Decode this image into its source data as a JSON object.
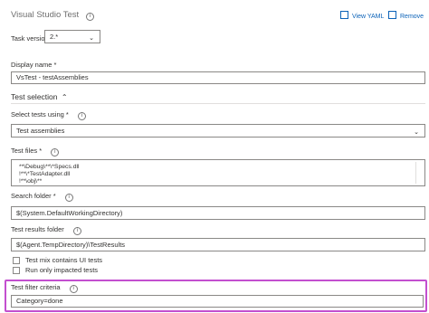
{
  "header": {
    "title": "Visual Studio Test",
    "view_yaml": "View YAML",
    "remove": "Remove"
  },
  "task_version": {
    "label": "Task version",
    "value": "2.*"
  },
  "display_name": {
    "label": "Display name *",
    "value": "VsTest - testAssemblies"
  },
  "section": {
    "title": "Test selection"
  },
  "select_tests_using": {
    "label": "Select tests using *",
    "value": "Test assemblies"
  },
  "test_files": {
    "label": "Test files *",
    "lines": [
      "**\\Debug\\**\\*Specs.dll",
      "!**\\*TestAdapter.dll",
      "!**\\obj\\**"
    ]
  },
  "search_folder": {
    "label": "Search folder *",
    "value": "$(System.DefaultWorkingDirectory)"
  },
  "test_results_folder": {
    "label": "Test results folder",
    "value": "$(Agent.TempDirectory)\\TestResults"
  },
  "test_filter": {
    "label": "Test filter criteria",
    "value": "Category=done"
  },
  "checkboxes": {
    "impacted": "Run only impacted tests",
    "ui_tests": "Test mix contains UI tests"
  },
  "colors": {
    "highlight": "#c34fcf",
    "link": "#0b62b8"
  },
  "icons": [
    "info-icon",
    "view-yaml-icon",
    "remove-icon",
    "chevron-down-icon",
    "chevron-up-icon"
  ]
}
